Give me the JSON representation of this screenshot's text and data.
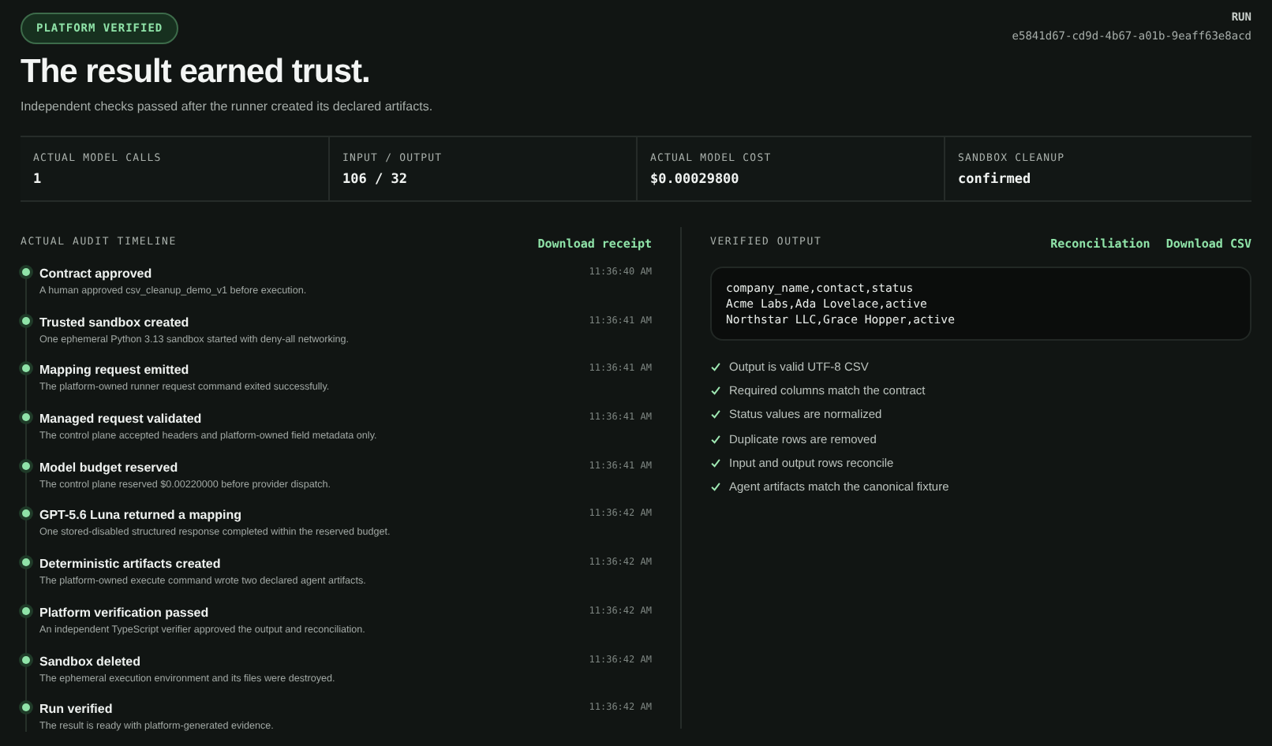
{
  "badge": "PLATFORM VERIFIED",
  "title": "The result earned trust.",
  "subtitle": "Independent checks passed after the runner created its declared artifacts.",
  "run": {
    "label": "RUN",
    "id": "e5841d67-cd9d-4b67-a01b-9eaff63e8acd"
  },
  "stats": [
    {
      "label": "ACTUAL MODEL CALLS",
      "value": "1"
    },
    {
      "label": "INPUT / OUTPUT",
      "value": "106 / 32"
    },
    {
      "label": "ACTUAL MODEL COST",
      "value": "$0.00029800"
    },
    {
      "label": "SANDBOX CLEANUP",
      "value": "confirmed"
    }
  ],
  "timeline": {
    "heading": "ACTUAL AUDIT TIMELINE",
    "links": [
      "Download receipt"
    ],
    "events": [
      {
        "title": "Contract approved",
        "description": "A human approved csv_cleanup_demo_v1 before execution.",
        "time": "11:36:40 AM"
      },
      {
        "title": "Trusted sandbox created",
        "description": "One ephemeral Python 3.13 sandbox started with deny-all networking.",
        "time": "11:36:41 AM"
      },
      {
        "title": "Mapping request emitted",
        "description": "The platform-owned runner request command exited successfully.",
        "time": "11:36:41 AM"
      },
      {
        "title": "Managed request validated",
        "description": "The control plane accepted headers and platform-owned field metadata only.",
        "time": "11:36:41 AM"
      },
      {
        "title": "Model budget reserved",
        "description": "The control plane reserved $0.00220000 before provider dispatch.",
        "time": "11:36:41 AM"
      },
      {
        "title": "GPT-5.6 Luna returned a mapping",
        "description": "One stored-disabled structured response completed within the reserved budget.",
        "time": "11:36:42 AM"
      },
      {
        "title": "Deterministic artifacts created",
        "description": "The platform-owned execute command wrote two declared agent artifacts.",
        "time": "11:36:42 AM"
      },
      {
        "title": "Platform verification passed",
        "description": "An independent TypeScript verifier approved the output and reconciliation.",
        "time": "11:36:42 AM"
      },
      {
        "title": "Sandbox deleted",
        "description": "The ephemeral execution environment and its files were destroyed.",
        "time": "11:36:42 AM"
      },
      {
        "title": "Run verified",
        "description": "The result is ready with platform-generated evidence.",
        "time": "11:36:42 AM"
      }
    ]
  },
  "output": {
    "heading": "VERIFIED OUTPUT",
    "links": [
      "Reconciliation",
      "Download CSV"
    ],
    "csv_lines": [
      "company_name,contact,status",
      "Acme Labs,Ada Lovelace,active",
      "Northstar LLC,Grace Hopper,active"
    ],
    "checks": [
      {
        "label": "Output is valid UTF-8 CSV",
        "checked": true
      },
      {
        "label": "Required columns match the contract",
        "checked": true
      },
      {
        "label": "Status values are normalized",
        "checked": true
      },
      {
        "label": "Duplicate rows are removed",
        "checked": true
      },
      {
        "label": "Input and output rows reconcile",
        "checked": true
      },
      {
        "label": "Agent artifacts match the canonical fixture",
        "checked": true
      }
    ]
  }
}
